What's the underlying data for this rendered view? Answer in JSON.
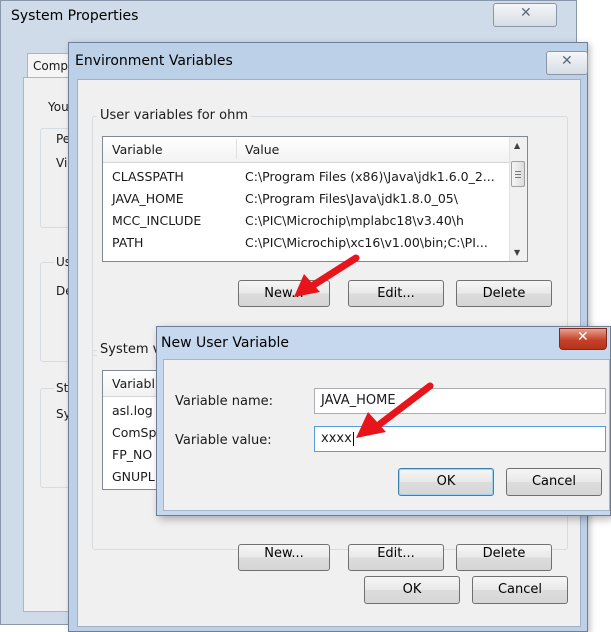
{
  "system_properties": {
    "title": "System Properties",
    "close_glyph": "✕",
    "tab_fragment": "Comp",
    "fragments": [
      "You",
      "Pe",
      "Vi",
      "Us",
      "De",
      "St",
      "Sy"
    ]
  },
  "environment_variables": {
    "title": "Environment Variables",
    "close_glyph": "✕",
    "user_group_label": "User variables for ohm",
    "user_table": {
      "columns": [
        "Variable",
        "Value"
      ],
      "rows": [
        {
          "variable": "CLASSPATH",
          "value": "C:\\Program Files (x86)\\Java\\jdk1.6.0_2..."
        },
        {
          "variable": "JAVA_HOME",
          "value": "C:\\Program Files\\Java\\jdk1.8.0_05\\"
        },
        {
          "variable": "MCC_INCLUDE",
          "value": "C:\\PIC\\Microchip\\mplabc18\\v3.40\\h"
        },
        {
          "variable": "PATH",
          "value": "C:\\PIC\\Microchip\\xc16\\v1.00\\bin;C:\\PI..."
        }
      ]
    },
    "user_buttons": {
      "new": "New...",
      "edit": "Edit...",
      "delete": "Delete"
    },
    "system_group_label": "System v",
    "system_table": {
      "column_fragment": "Variabl",
      "rows": [
        "asl.log",
        "ComSp",
        "FP_NO",
        "GNUPL"
      ]
    },
    "system_buttons": {
      "new": "New...",
      "edit": "Edit...",
      "delete": "Delete"
    },
    "ok": "OK",
    "cancel": "Cancel"
  },
  "new_user_variable": {
    "title": "New User Variable",
    "close_glyph": "✕",
    "name_label": "Variable name:",
    "name_value": "JAVA_HOME",
    "value_label": "Variable value:",
    "value_value": "xxxx",
    "ok": "OK",
    "cancel": "Cancel"
  },
  "colors": {
    "window_frame": "#bcd1e8",
    "dialog_bg": "#f0f0f0",
    "close_red": "#c4422a",
    "annotation_arrow": "#e8141b"
  }
}
